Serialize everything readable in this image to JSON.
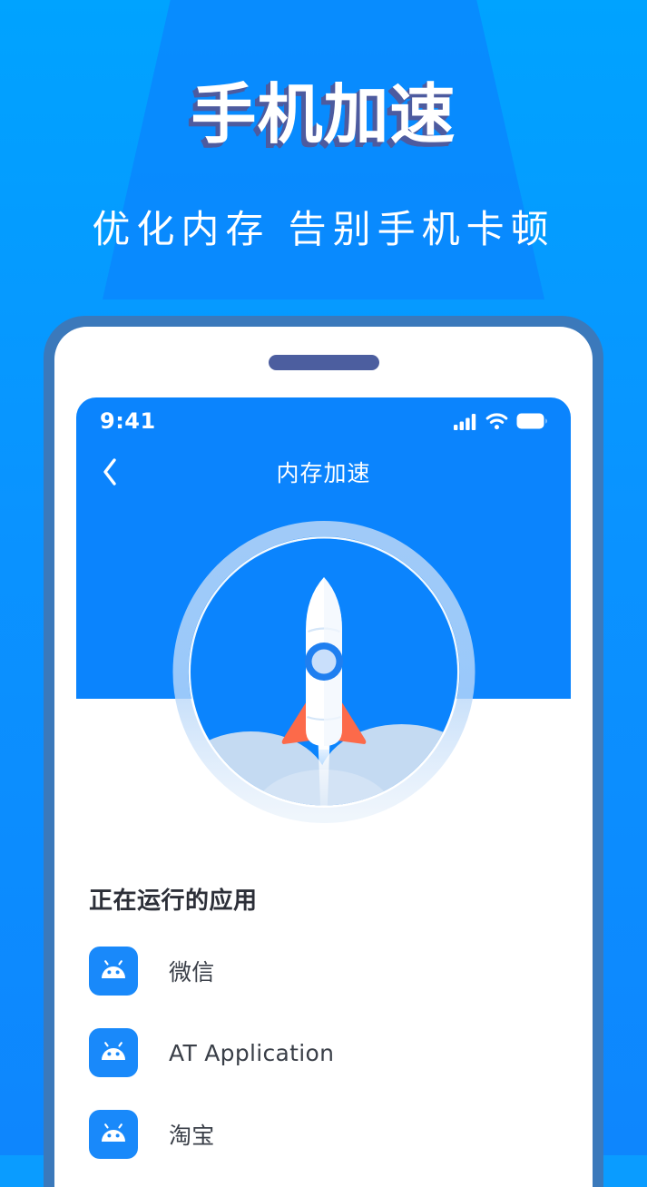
{
  "page": {
    "headline": "手机加速",
    "subline": "优化内存 告别手机卡顿",
    "bg_color_top": "#00a3ff",
    "bg_color_bottom": "#0e86fd",
    "beam_color": "#0b84fd",
    "headline_fill": "#ffffff",
    "headline_shadow": "#4d5b9f"
  },
  "phone": {
    "bezel_color": "#3b79bb",
    "speaker_color": "#4c5e9f",
    "screen_bg": "#ffffff"
  },
  "status_bar": {
    "time": "9:41",
    "icons": [
      "signal-bars-icon",
      "wifi-icon",
      "battery-icon"
    ],
    "signal_bars": 4,
    "battery_level": 100
  },
  "nav_bar": {
    "back_icon": "chevron-left-icon",
    "title": "内存加速",
    "bg_color": "#0b84fd"
  },
  "gauge": {
    "illustration": "rocket-launch-illustration",
    "ring_track_color": "#9fc9f7",
    "ring_inner_line_color": "#ffffff",
    "circle_fill": "#0b84fd",
    "rocket_body_color": "#ffffff",
    "rocket_fin_color": "#fc6a4a",
    "rocket_window_color": "#c9dffb",
    "rocket_window_ring_color": "#1f7ff0",
    "cloud_color": "#c4daf2"
  },
  "apps": {
    "section_title": "正在运行的应用",
    "items": [
      {
        "icon": "android-robot-icon",
        "name": "微信"
      },
      {
        "icon": "android-robot-icon",
        "name": "AT Application"
      },
      {
        "icon": "android-robot-icon",
        "name": "淘宝"
      }
    ]
  }
}
